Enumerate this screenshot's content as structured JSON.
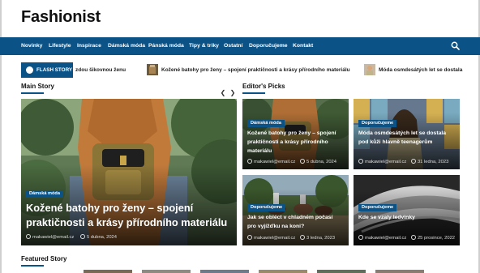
{
  "site": {
    "title": "Fashionist"
  },
  "nav": {
    "items": [
      "Novinky",
      "Lifestyle",
      "Inspirace",
      "Dámská móda",
      "Pánská móda",
      "Tipy & triky",
      "Ostatní",
      "Doporučujeme",
      "Kontakt"
    ],
    "search_icon": "search-icon"
  },
  "ticker": {
    "label": "FLASH STORY",
    "items": [
      "zdou šikovnou ženu",
      "Kožené batohy pro ženy – spojení praktičnosti a krásy přírodního materiálu",
      "Móda osmdesátých let se dostala"
    ]
  },
  "sections": {
    "main": "Main Story",
    "editors": "Editor's Picks",
    "featured": "Featured Story"
  },
  "main_story": {
    "category": "Dámská móda",
    "title": "Kožené batohy pro ženy – spojení praktičnosti a krásy přírodního materiálu",
    "author": "makawiel@email.cz",
    "date": "5 dubna, 2024"
  },
  "editors_picks": [
    {
      "category": "Dámská móda",
      "title": "Kožené batohy pro ženy – spojení praktičnosti a krásy přírodního materiálu",
      "author": "makawiel@email.cz",
      "date": "5 dubna, 2024"
    },
    {
      "category": "Doporučujeme",
      "title": "Móda osmdesátých let se dostala pod kůži hlavně teenagerům",
      "author": "makawiel@email.cz",
      "date": "31 ledna, 2023"
    },
    {
      "category": "Doporučujeme",
      "title": "Jak se obléct v chladném počasí pro vyjížďku na koni?",
      "author": "makawiel@email.cz",
      "date": "3 ledna, 2023"
    },
    {
      "category": "Doporučujeme",
      "title": "Kde se vzaly ledvinky",
      "author": "makawiel@email.cz",
      "date": "25 prosince, 2022"
    }
  ],
  "colors": {
    "brand": "#0b5286"
  }
}
